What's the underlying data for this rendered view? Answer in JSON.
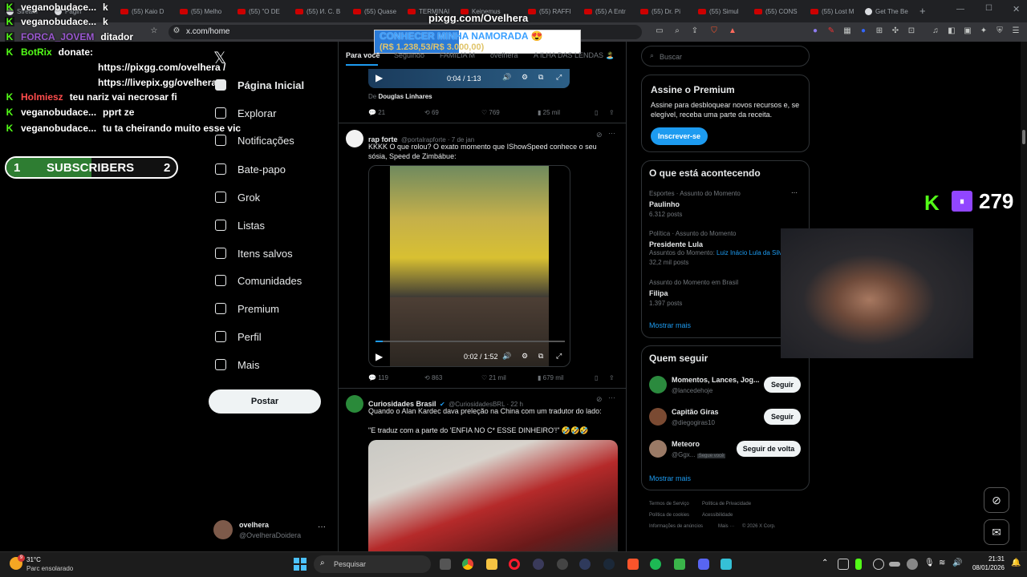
{
  "browser": {
    "tabs": [
      {
        "label": "Stream",
        "icon": "stream-icon"
      },
      {
        "label": "Págin",
        "icon": "page-icon"
      },
      {
        "label": "(55) Kaio D",
        "icon": "youtube-icon"
      },
      {
        "label": "(55) Melho",
        "icon": "youtube-icon"
      },
      {
        "label": "(55) \"O DE",
        "icon": "youtube-icon"
      },
      {
        "label": "(55) И. С. В",
        "icon": "youtube-icon"
      },
      {
        "label": "(55) Quase",
        "icon": "youtube-icon"
      },
      {
        "label": "TERMINAI",
        "icon": "youtube-icon"
      },
      {
        "label": "Keinemus",
        "icon": "youtube-icon"
      },
      {
        "label": "(55) RAFFI",
        "icon": "youtube-icon"
      },
      {
        "label": "(55) A Entr",
        "icon": "youtube-icon"
      },
      {
        "label": "(55) Dr. Pi",
        "icon": "youtube-icon"
      },
      {
        "label": "(55) Simul",
        "icon": "youtube-icon"
      },
      {
        "label": "(55) CONS",
        "icon": "youtube-icon"
      },
      {
        "label": "(55) Lost M",
        "icon": "youtube-icon"
      },
      {
        "label": "Get The Be",
        "icon": "globe-icon"
      }
    ],
    "url": "x.com/home"
  },
  "overlay": {
    "pix_url": "pixgg.com/Ovelhera",
    "goal_title": "CONHECER MINHA NAMORADA 😍",
    "goal_amount": "(R$ 1.238,53/R$ 3.000,00)",
    "goal_progress": 0.41,
    "chat": [
      {
        "user": "veganobudace...",
        "msg": "k",
        "color": "#ffffff"
      },
      {
        "user": "veganobudace...",
        "msg": "k",
        "color": "#ffffff"
      },
      {
        "user": "FORCA_JOVEM",
        "msg": "ditador",
        "color": "#9b59d0"
      },
      {
        "user": "BotRix",
        "msg": "donate:",
        "color": "#53fc18"
      },
      {
        "user": "",
        "msg": "https://pixgg.com/ovelhera /",
        "color": "#ffffff"
      },
      {
        "user": "",
        "msg": "https://livepix.gg/ovelhera",
        "color": "#ffffff"
      },
      {
        "user": "Holmiesz",
        "msg": "teu nariz vai necrosar fi",
        "color": "#ff4d4d"
      },
      {
        "user": "veganobudace...",
        "msg": "pprt ze",
        "color": "#ffffff"
      },
      {
        "user": "veganobudace...",
        "msg": "tu ta cheirando muito esse vic",
        "color": "#ffffff"
      }
    ],
    "subs_left": "1",
    "subs_label": "SUBSCRIBERS",
    "subs_right": "2",
    "subs_progress": 0.5,
    "viewers": "279"
  },
  "nav": {
    "items": [
      {
        "label": "Página Inicial",
        "icon": "home-icon"
      },
      {
        "label": "Explorar",
        "icon": "search-icon"
      },
      {
        "label": "Notificações",
        "icon": "bell-icon"
      },
      {
        "label": "Bate-papo",
        "icon": "mail-icon"
      },
      {
        "label": "Grok",
        "icon": "grok-icon"
      },
      {
        "label": "Listas",
        "icon": "list-icon"
      },
      {
        "label": "Itens salvos",
        "icon": "bookmark-icon"
      },
      {
        "label": "Comunidades",
        "icon": "people-icon"
      },
      {
        "label": "Premium",
        "icon": "x-logo-icon"
      },
      {
        "label": "Perfil",
        "icon": "user-icon"
      },
      {
        "label": "Mais",
        "icon": "more-icon"
      }
    ],
    "post_label": "Postar",
    "account_name": "ovelhera",
    "account_handle": "@OvelheraDoidera"
  },
  "feed": {
    "tabs": [
      "Para você",
      "Seguindo",
      "FAMILIA M",
      "ovelhera",
      "A ILHA DAS LENDAS 🏝️"
    ],
    "tweet0": {
      "video_time": "0:04 / 1:13",
      "from_label": "De",
      "from_name": "Douglas Linhares",
      "replies": "21",
      "reposts": "69",
      "likes": "769",
      "views": "25 mil"
    },
    "tweet1": {
      "name": "rap forte",
      "handle": "@portalrapforte · 7 de jan",
      "text": "KKKK O que rolou? O exato momento que IShowSpeed conhece o seu sósia, Speed de Zimbábue:",
      "video_time": "0:02 / 1:52",
      "replies": "119",
      "reposts": "863",
      "likes": "21 mil",
      "views": "679 mil"
    },
    "tweet2": {
      "name": "Curiosidades Brasil",
      "handle": "@CuriosidadesBRL · 22 h",
      "text1": "Quando o Alan Kardec dava preleção na China com um tradutor do lado:",
      "text2": "\"E traduz com a parte do 'ENFIA NO C* ESSE DINHEIRO'!\" 🤣🤣🤣"
    }
  },
  "right": {
    "search_placeholder": "Buscar",
    "premium_title": "Assine o Premium",
    "premium_text": "Assine para desbloquear novos recursos e, se elegível, receba uma parte da receita.",
    "premium_button": "Inscrever-se",
    "trending_title": "O que está acontecendo",
    "trends": [
      {
        "context": "Esportes · Assunto do Momento",
        "topic": "Paulinho",
        "posts": "6.312 posts",
        "related": ""
      },
      {
        "context": "Política · Assunto do Momento",
        "topic": "Presidente Lula",
        "posts": "32,2 mil posts",
        "related_label": "Assuntos do Momento:",
        "related": "Luiz Inácio Lula da Silva"
      },
      {
        "context": "Assunto do Momento em Brasil",
        "topic": "Filipa",
        "posts": "1.397 posts",
        "related": ""
      }
    ],
    "show_more": "Mostrar mais",
    "who_title": "Quem seguir",
    "who": [
      {
        "name": "Momentos, Lances, Jog...",
        "handle": "@lancedehoje",
        "button": "Seguir",
        "badge": ""
      },
      {
        "name": "Capitão Giras",
        "handle": "@diegogiras10",
        "button": "Seguir",
        "badge": ""
      },
      {
        "name": "Meteoro",
        "handle": "@Ggx...",
        "button": "Seguir de volta",
        "badge": "Segue você"
      }
    ],
    "who_more": "Mostrar mais",
    "footer": [
      "Termos de Serviço",
      "Política de Privacidade",
      "Política de cookies",
      "Acessibilidade",
      "Informações de anúncios",
      "Mais ···",
      "© 2026 X Corp."
    ]
  },
  "taskbar": {
    "weather_temp": "31°C",
    "weather_desc": "Parc ensolarado",
    "notif_count": "9",
    "search_label": "Pesquisar",
    "time": "21:31",
    "date": "08/01/2026"
  }
}
